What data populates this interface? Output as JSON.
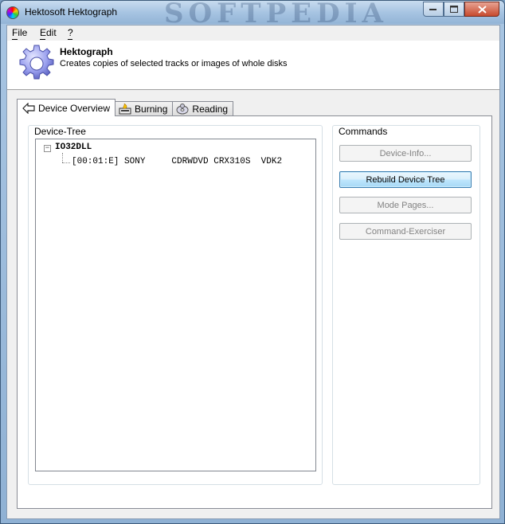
{
  "window": {
    "title": "Hektosoft Hektograph",
    "watermark": "SOFTPEDIA"
  },
  "menu": {
    "items": [
      {
        "label": "File"
      },
      {
        "label": "Edit"
      },
      {
        "label": "?"
      }
    ]
  },
  "header": {
    "title": "Hektograph",
    "subtitle": "Creates copies of selected tracks or images of whole disks",
    "icon": "gear-icon"
  },
  "tabs": [
    {
      "label": "Device Overview",
      "icon": "back-arrow-icon",
      "active": true
    },
    {
      "label": "Burning",
      "icon": "burn-disk-icon",
      "active": false
    },
    {
      "label": "Reading",
      "icon": "read-disk-icon",
      "active": false
    }
  ],
  "device_tree": {
    "label": "Device-Tree",
    "root": "IO32DLL",
    "children": [
      "[00:01:E] SONY     CDRWDVD CRX310S  VDK2"
    ]
  },
  "commands": {
    "label": "Commands",
    "buttons": [
      {
        "label": "Device-Info...",
        "enabled": false
      },
      {
        "label": "Rebuild Device Tree",
        "enabled": true
      },
      {
        "label": "Mode Pages...",
        "enabled": false
      },
      {
        "label": "Command-Exerciser",
        "enabled": false
      }
    ]
  },
  "colors": {
    "title_bar": "#a7c4e2",
    "client_bg": "#f0f0f0",
    "focus_button": "#3c7fb1",
    "disabled_text": "#838383"
  }
}
